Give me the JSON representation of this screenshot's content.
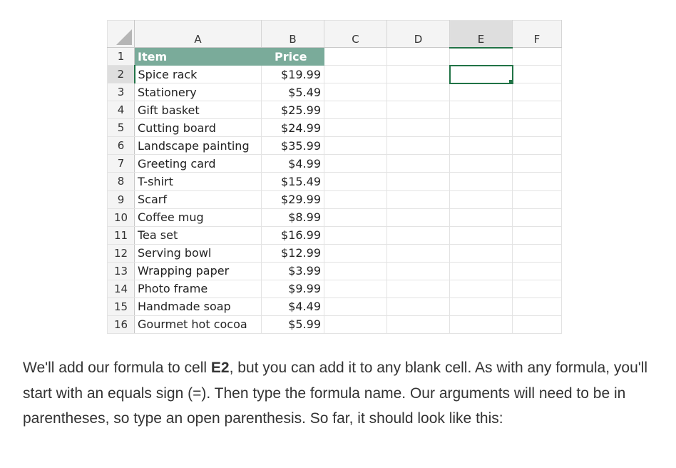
{
  "sheet": {
    "columns": [
      "A",
      "B",
      "C",
      "D",
      "E",
      "F"
    ],
    "selected_column": "E",
    "selected_row": 2,
    "header": {
      "item": "Item",
      "price": "Price"
    },
    "rows": [
      {
        "n": "1"
      },
      {
        "n": "2",
        "item": "Spice rack",
        "price": "$19.99"
      },
      {
        "n": "3",
        "item": "Stationery",
        "price": "$5.49"
      },
      {
        "n": "4",
        "item": "Gift basket",
        "price": "$25.99"
      },
      {
        "n": "5",
        "item": "Cutting board",
        "price": "$24.99"
      },
      {
        "n": "6",
        "item": "Landscape painting",
        "price": "$35.99"
      },
      {
        "n": "7",
        "item": "Greeting card",
        "price": "$4.99"
      },
      {
        "n": "8",
        "item": "T-shirt",
        "price": "$15.49"
      },
      {
        "n": "9",
        "item": "Scarf",
        "price": "$29.99"
      },
      {
        "n": "10",
        "item": "Coffee mug",
        "price": "$8.99"
      },
      {
        "n": "11",
        "item": "Tea set",
        "price": "$16.99"
      },
      {
        "n": "12",
        "item": "Serving bowl",
        "price": "$12.99"
      },
      {
        "n": "13",
        "item": "Wrapping paper",
        "price": "$3.99"
      },
      {
        "n": "14",
        "item": "Photo frame",
        "price": "$9.99"
      },
      {
        "n": "15",
        "item": "Handmade soap",
        "price": "$4.49"
      },
      {
        "n": "16",
        "item": "Gourmet hot cocoa",
        "price": "$5.99"
      }
    ]
  },
  "caption": {
    "part1": "We'll add our formula to cell ",
    "bold": "E2",
    "part2": ", but you can add it to any blank cell. As with any formula, you'll start with an equals sign (=). Then type the formula name. Our arguments will need to be in parentheses, so type an open parenthesis. So far, it should look like this:"
  },
  "colors": {
    "header_fill": "#7aab9a",
    "selection": "#217346"
  }
}
